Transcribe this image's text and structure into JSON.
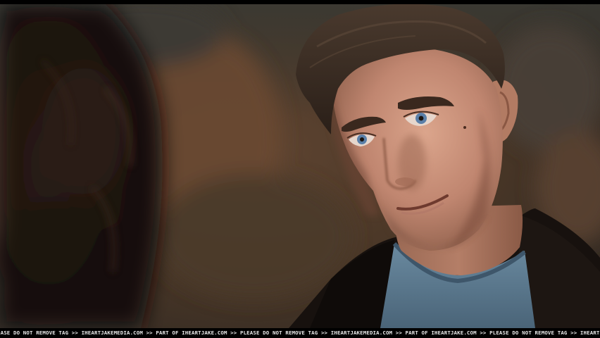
{
  "watermark": {
    "text": "EASE DO NOT REMOVE TAG >> IHEARTJAKEMEDIA.COM >> PART OF IHEARTJAKE.COM >> PLEASE DO NOT REMOVE TAG >> IHEARTJAKEMEDIA.COM >> PART OF IHEARTJAKE.COM >> PLEASE DO NOT REMOVE TAG >> IHEARTJAKE"
  },
  "colors": {
    "background_warm": "#4a3526",
    "background_cool": "#3a3a36",
    "skin": "#c8917a",
    "hair": "#3a2a20",
    "jacket": "#15110f",
    "shirt": "#5a7a90",
    "eyes": "#5a7fa8"
  }
}
